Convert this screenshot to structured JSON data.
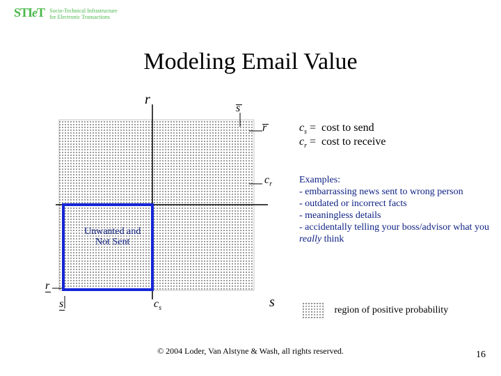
{
  "logo": {
    "brand": "STI",
    "brand_e": "e",
    "brand_t": "T",
    "sub1": "Socio-Technical Infrastructure",
    "sub2": "for Electronic Transactions"
  },
  "title": "Modeling Email Value",
  "diagram": {
    "axis_r": "r",
    "axis_s": "s",
    "mark_s_bar": "s",
    "mark_r_bar": "r",
    "lab_cr": "c",
    "lab_cr_sub": "r",
    "lab_cs": "c",
    "lab_cs_sub": "s",
    "lab_r_underscore": "r",
    "lab_s_underscore": "s",
    "quadrant_label_l1": "Unwanted and",
    "quadrant_label_l2": "Not Sent"
  },
  "costs": {
    "cs_label": "c",
    "cs_sub": "s",
    "cs_def": "cost to send",
    "cr_label": "c",
    "cr_sub": "r",
    "cr_def": "cost to receive"
  },
  "examples": {
    "title": "Examples:",
    "items": [
      "- embarrassing news sent to wrong person",
      "- outdated or incorrect facts",
      "- meaningless details"
    ],
    "last_prefix": "- accidentally telling your boss/advisor what you ",
    "last_emph": "really",
    "last_suffix": " think"
  },
  "legend": "region of positive probability",
  "copyright": "© 2004 Loder, Van Alstyne & Wash, all rights reserved.",
  "page": "16"
}
